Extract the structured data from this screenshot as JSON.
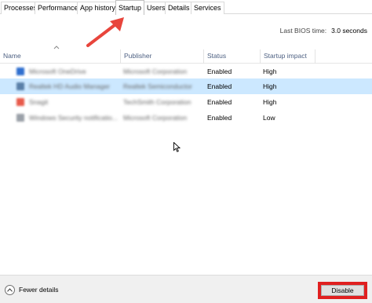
{
  "tabs": [
    {
      "label": "Processes",
      "active": false
    },
    {
      "label": "Performance",
      "active": false
    },
    {
      "label": "App history",
      "active": false
    },
    {
      "label": "Startup",
      "active": true
    },
    {
      "label": "Users",
      "active": false
    },
    {
      "label": "Details",
      "active": false
    },
    {
      "label": "Services",
      "active": false
    }
  ],
  "bios": {
    "label": "Last BIOS time:",
    "value": "3.0 seconds"
  },
  "columns": {
    "name": "Name",
    "publisher": "Publisher",
    "status": "Status",
    "impact": "Startup impact"
  },
  "rows": [
    {
      "name": "Microsoft OneDrive",
      "publisher": "Microsoft Corporation",
      "status": "Enabled",
      "impact": "High",
      "icon_color": "#2f6fcf",
      "selected": false
    },
    {
      "name": "Realtek HD Audio Manager",
      "publisher": "Realtek Semiconductor",
      "status": "Enabled",
      "impact": "High",
      "icon_color": "#5a7fa8",
      "selected": true
    },
    {
      "name": "Snagit",
      "publisher": "TechSmith Corporation",
      "status": "Enabled",
      "impact": "High",
      "icon_color": "#e85a4a",
      "selected": false
    },
    {
      "name": "Windows Security notificatio...",
      "publisher": "Microsoft Corporation",
      "status": "Enabled",
      "impact": "Low",
      "icon_color": "#9aa0a8",
      "selected": false
    }
  ],
  "footer": {
    "fewer_details": "Fewer details",
    "disable": "Disable"
  },
  "colors": {
    "selected_row": "#cce8ff",
    "highlight_red": "#e02020",
    "header_text": "#4d6082"
  }
}
